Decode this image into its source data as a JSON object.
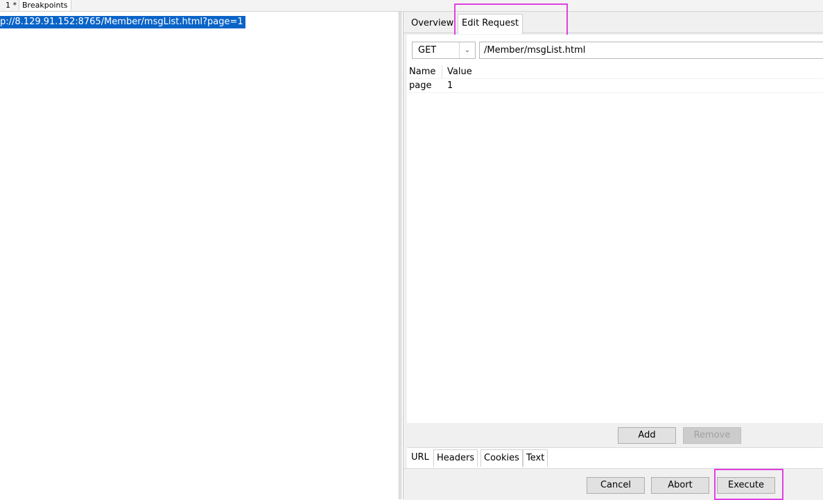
{
  "top_tabs": [
    {
      "label": "1 *"
    },
    {
      "label": "Breakpoints"
    }
  ],
  "left": {
    "selected_url": "p://8.129.91.152:8765/Member/msgList.html?page=1"
  },
  "right_tabs": [
    {
      "label": "Overview"
    },
    {
      "label": "Edit Request"
    }
  ],
  "request": {
    "method": "GET",
    "path": "/Member/msgList.html"
  },
  "params": {
    "headers": [
      "Name",
      "Value"
    ],
    "rows": [
      {
        "name": "page",
        "value": "1"
      }
    ]
  },
  "buttons": {
    "add": "Add",
    "remove": "Remove",
    "cancel": "Cancel",
    "abort": "Abort",
    "execute": "Execute"
  },
  "sub_tabs": [
    {
      "label": "URL"
    },
    {
      "label": "Headers"
    },
    {
      "label": "Cookies"
    },
    {
      "label": "Text"
    }
  ],
  "colors": {
    "selection": "#0a64c8",
    "highlight": "#e040e0"
  }
}
